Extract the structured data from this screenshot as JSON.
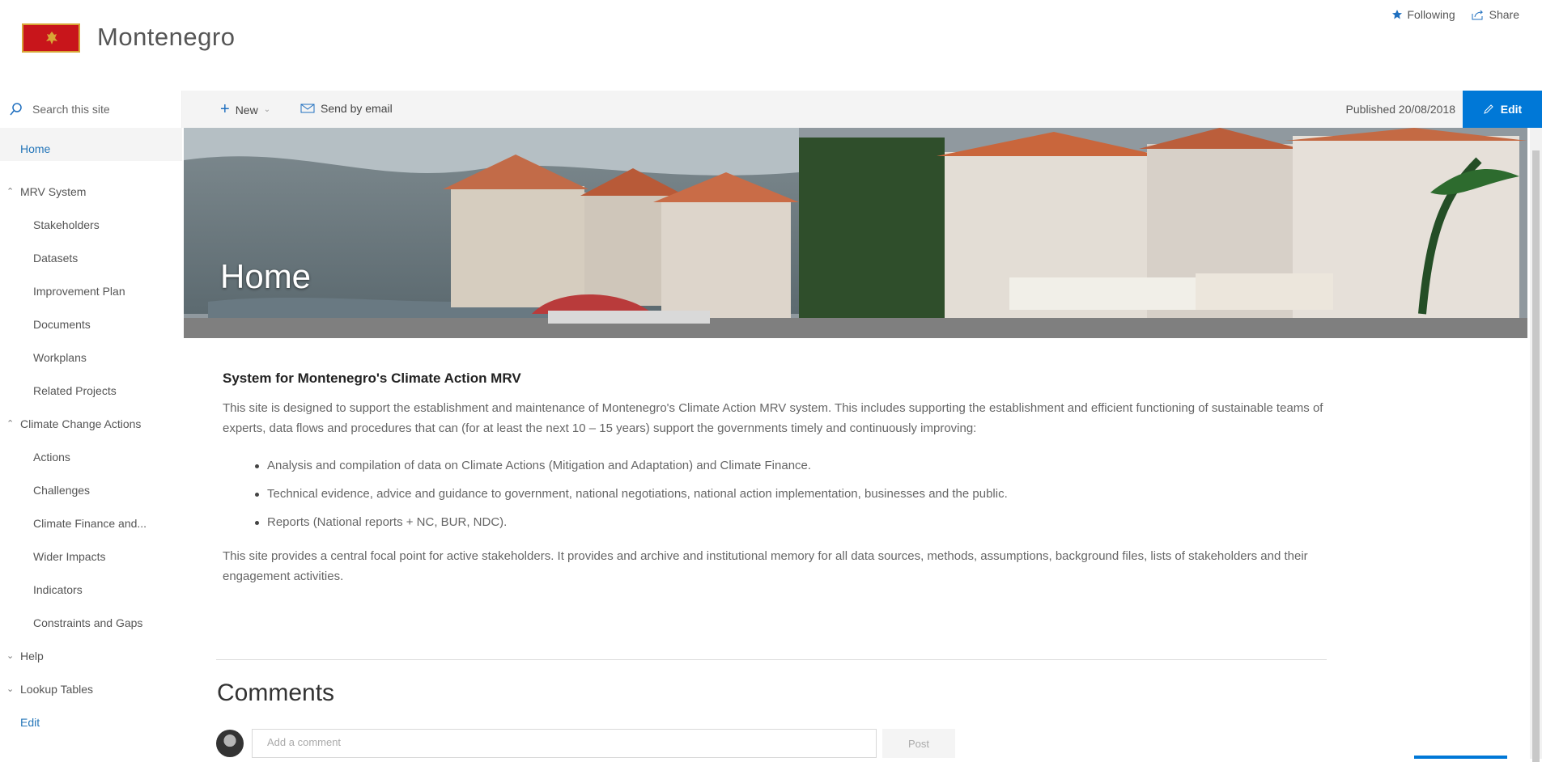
{
  "site": {
    "title": "Montenegro"
  },
  "top_actions": {
    "following": "Following",
    "share": "Share"
  },
  "search": {
    "placeholder": "Search this site"
  },
  "command_bar": {
    "new_label": "New",
    "send_email_label": "Send by email",
    "published": "Published 20/08/2018",
    "edit_label": "Edit"
  },
  "sidebar": {
    "items": [
      {
        "label": "Home"
      },
      {
        "label": "MRV System"
      },
      {
        "label": "Stakeholders"
      },
      {
        "label": "Datasets"
      },
      {
        "label": "Improvement Plan"
      },
      {
        "label": "Documents"
      },
      {
        "label": "Workplans"
      },
      {
        "label": "Related Projects"
      },
      {
        "label": "Climate Change Actions"
      },
      {
        "label": "Actions"
      },
      {
        "label": "Challenges"
      },
      {
        "label": "Climate Finance and..."
      },
      {
        "label": "Wider Impacts"
      },
      {
        "label": "Indicators"
      },
      {
        "label": "Constraints and Gaps"
      },
      {
        "label": "Help"
      },
      {
        "label": "Lookup Tables"
      },
      {
        "label": "Edit"
      }
    ]
  },
  "banner": {
    "title": "Home"
  },
  "article": {
    "heading": "System for Montenegro's Climate Action MRV",
    "intro": "This site is designed to support the establishment and maintenance of Montenegro's Climate Action MRV system.  This includes supporting the establishment and efficient functioning of sustainable teams of experts, data flows and procedures that can (for at least the next 10 – 15 years) support the governments timely and continuously improving:",
    "bullets": [
      "Analysis and compilation of data on Climate Actions (Mitigation and Adaptation) and Climate Finance.",
      "Technical evidence, advice and guidance to government, national negotiations, national action implementation, businesses and the public.",
      "Reports (National reports + NC, BUR, NDC)."
    ],
    "outro": "This site provides a central focal point for active stakeholders.  It provides and archive and institutional memory for all data sources, methods, assumptions, background files, lists of stakeholders and their engagement activities."
  },
  "comments": {
    "heading": "Comments",
    "input_placeholder": "Add a comment",
    "post_label": "Post"
  },
  "colors": {
    "accent": "#0078d7",
    "nav_selected": "#2576b9",
    "flag_red": "#c8151b"
  },
  "icons": {
    "search": "search-icon",
    "plus": "plus-icon",
    "mail": "mail-icon",
    "star": "star-icon",
    "share": "share-icon",
    "pencil": "pencil-icon",
    "chevron": "chevron-icon"
  }
}
